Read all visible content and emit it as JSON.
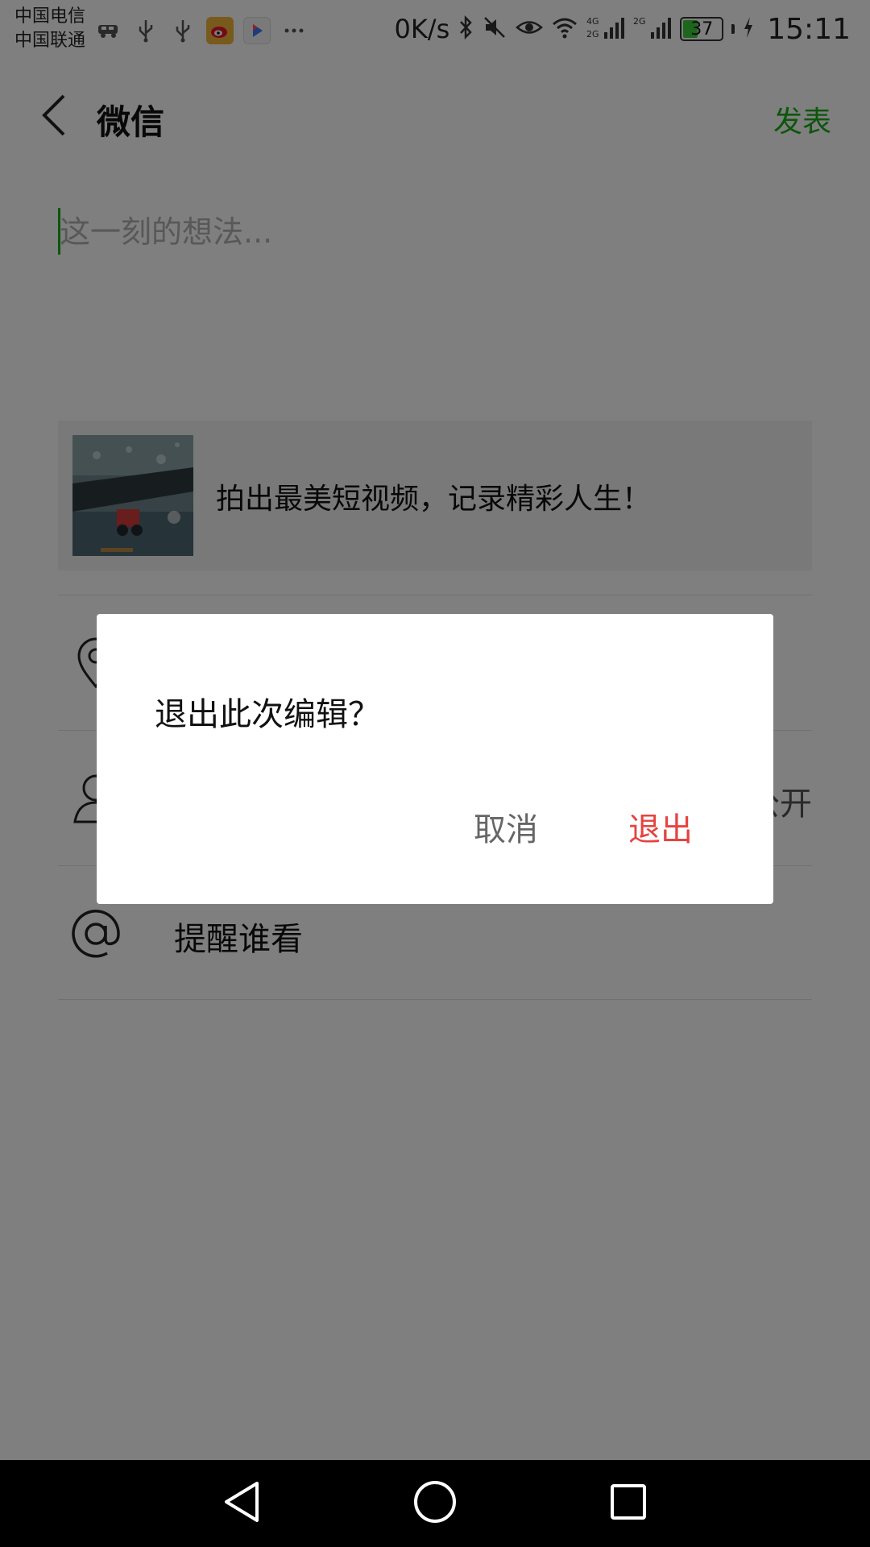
{
  "status_bar": {
    "carrier_1": "中国电信",
    "carrier_2": "中国联通",
    "net_speed": "0K/s",
    "battery_level": "37",
    "time": "15:11",
    "left_icons": [
      "car-icon",
      "usb-icon",
      "usb-icon",
      "weibo-icon",
      "video-app-icon",
      "more-icon"
    ],
    "right_icons": [
      "bluetooth-icon",
      "mute-icon",
      "eye-icon",
      "wifi-icon",
      "signal-4g-icon",
      "signal-2g-icon",
      "battery-icon",
      "charging-icon"
    ]
  },
  "header": {
    "title": "微信",
    "publish_label": "发表",
    "accent_color": "#1aad19"
  },
  "composer": {
    "placeholder": "这一刻的想法..."
  },
  "video_card": {
    "caption": "拍出最美短视频，记录精彩人生！"
  },
  "rows": [
    {
      "icon": "location-icon",
      "label": "",
      "value": ""
    },
    {
      "icon": "person-icon",
      "label": "",
      "value": "公开"
    },
    {
      "icon": "at-icon",
      "label": "提醒谁看",
      "value": ""
    }
  ],
  "dialog": {
    "message": "退出此次编辑？",
    "cancel_label": "取消",
    "exit_label": "退出",
    "exit_color": "#e64340"
  },
  "nav": {
    "icons": [
      "back-triangle-icon",
      "home-circle-icon",
      "recents-square-icon"
    ]
  }
}
